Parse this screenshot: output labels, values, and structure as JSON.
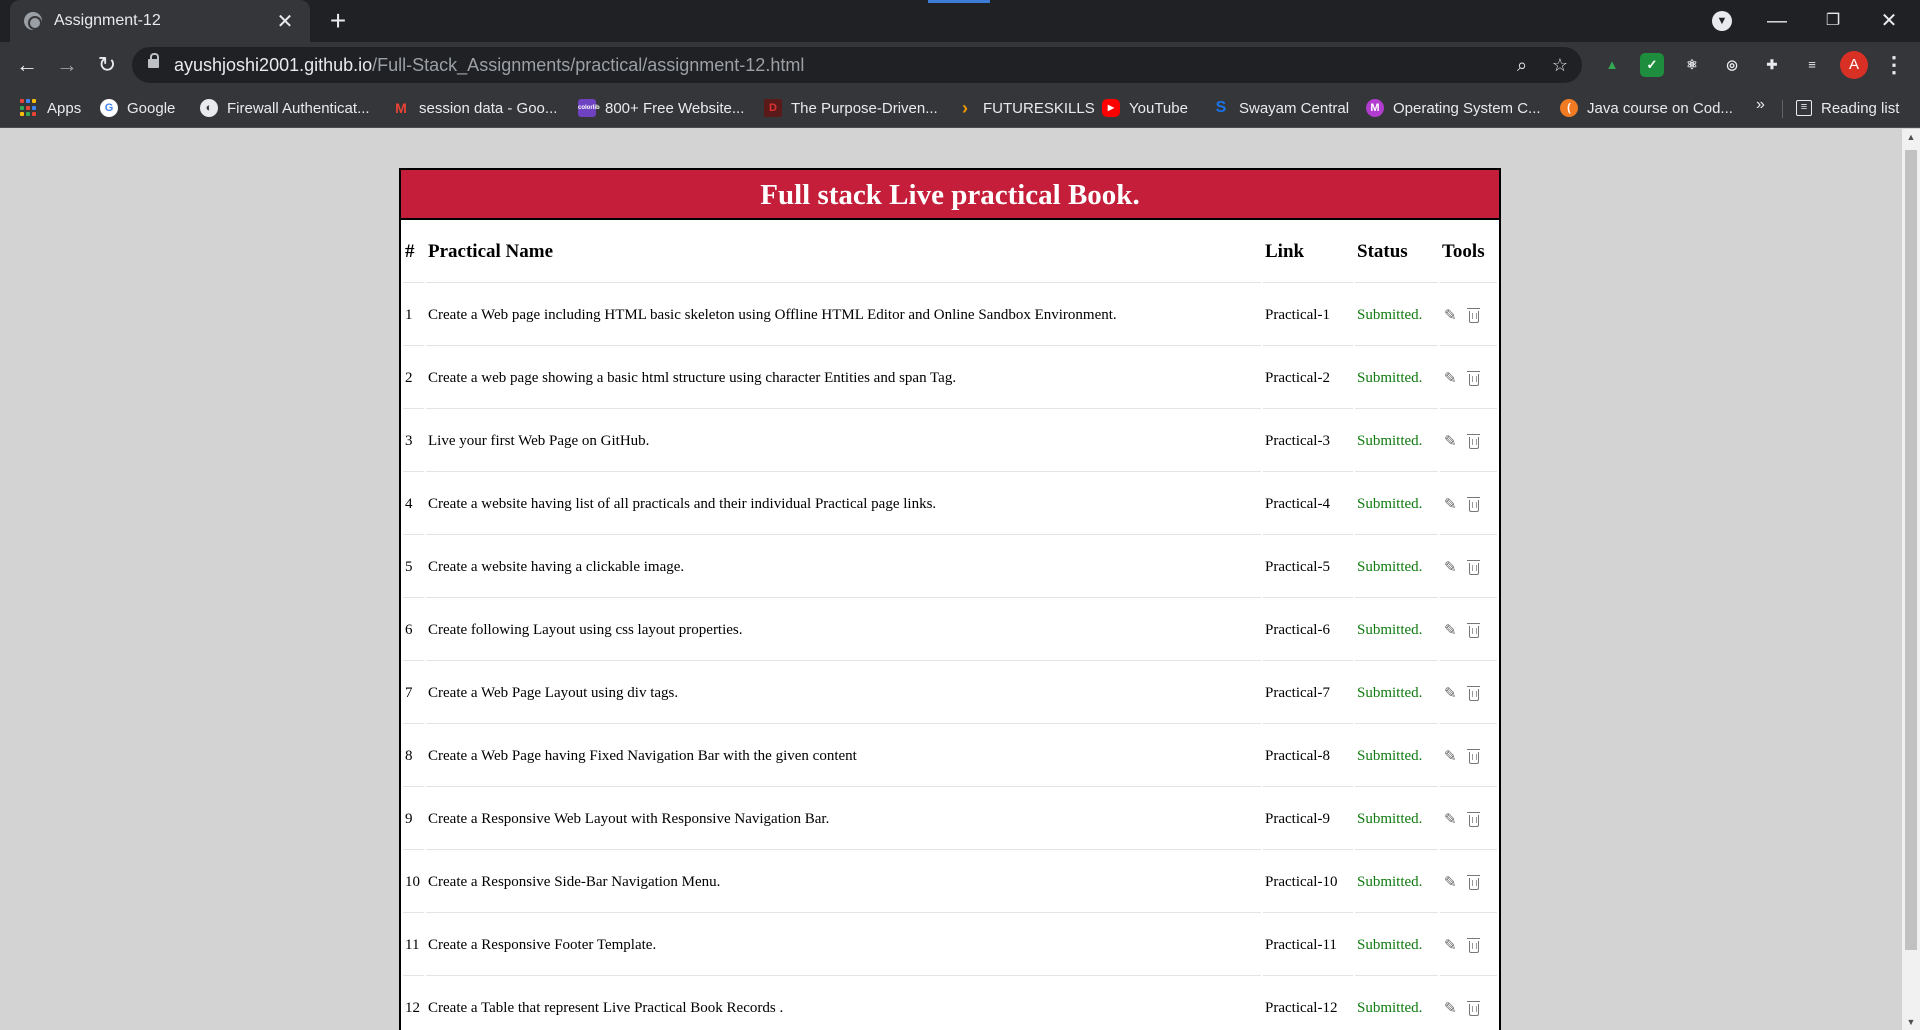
{
  "browser": {
    "tab_title": "Assignment-12",
    "url_host": "ayushjoshi2001.github.io",
    "url_path": "/Full-Stack_Assignments/practical/assignment-12.html",
    "profile_initial": "A",
    "bookmarks": [
      {
        "label": "Apps",
        "icon": "apps-grid-icon"
      },
      {
        "label": "Google",
        "icon": "google-icon"
      },
      {
        "label": "Firewall Authenticat...",
        "icon": "globe-icon"
      },
      {
        "label": "session data - Goo...",
        "icon": "gmail-icon"
      },
      {
        "label": "800+ Free Website...",
        "icon": "colorlib-icon"
      },
      {
        "label": "The Purpose-Driven...",
        "icon": "book-icon"
      },
      {
        "label": "FUTURESKILLS",
        "icon": "chevron-icon"
      },
      {
        "label": "YouTube",
        "icon": "youtube-icon"
      },
      {
        "label": "Swayam Central",
        "icon": "swayam-icon"
      },
      {
        "label": "Operating System C...",
        "icon": "m-icon"
      },
      {
        "label": "Java course on Cod...",
        "icon": "codechef-icon"
      }
    ],
    "bookmarks_more": "»",
    "reading_list": "Reading list"
  },
  "page": {
    "title": "Full stack Live practical Book.",
    "columns": [
      "#",
      "Practical Name",
      "Link",
      "Status",
      "Tools"
    ],
    "rows": [
      {
        "num": "1",
        "name": "Create a Web page including HTML basic skeleton using Offline HTML Editor and Online Sandbox Environment.",
        "link": "Practical-1",
        "status": "Submitted."
      },
      {
        "num": "2",
        "name": "Create a web page showing a basic html structure using character Entities and span Tag.",
        "link": "Practical-2",
        "status": "Submitted."
      },
      {
        "num": "3",
        "name": "Live your first Web Page on GitHub.",
        "link": "Practical-3",
        "status": "Submitted."
      },
      {
        "num": "4",
        "name": "Create a website having list of all practicals and their individual Practical page links.",
        "link": "Practical-4",
        "status": "Submitted."
      },
      {
        "num": "5",
        "name": "Create a website having a clickable image.",
        "link": "Practical-5",
        "status": "Submitted."
      },
      {
        "num": "6",
        "name": "Create following Layout using css layout properties.",
        "link": "Practical-6",
        "status": "Submitted."
      },
      {
        "num": "7",
        "name": "Create a Web Page Layout using div tags.",
        "link": "Practical-7",
        "status": "Submitted."
      },
      {
        "num": "8",
        "name": "Create a Web Page having Fixed Navigation Bar with the given content",
        "link": "Practical-8",
        "status": "Submitted."
      },
      {
        "num": "9",
        "name": "Create a Responsive Web Layout with Responsive Navigation Bar.",
        "link": "Practical-9",
        "status": "Submitted."
      },
      {
        "num": "10",
        "name": "Create a Responsive Side-Bar Navigation Menu.",
        "link": "Practical-10",
        "status": "Submitted."
      },
      {
        "num": "11",
        "name": "Create a Responsive Footer Template.",
        "link": "Practical-11",
        "status": "Submitted."
      },
      {
        "num": "12",
        "name": "Create a Table that represent Live Practical Book Records .",
        "link": "Practical-12",
        "status": "Submitted."
      }
    ]
  },
  "colors": {
    "header_bg": "#c41e3a",
    "status_green": "#0f7a0f",
    "page_bg": "#d3d3d3"
  }
}
